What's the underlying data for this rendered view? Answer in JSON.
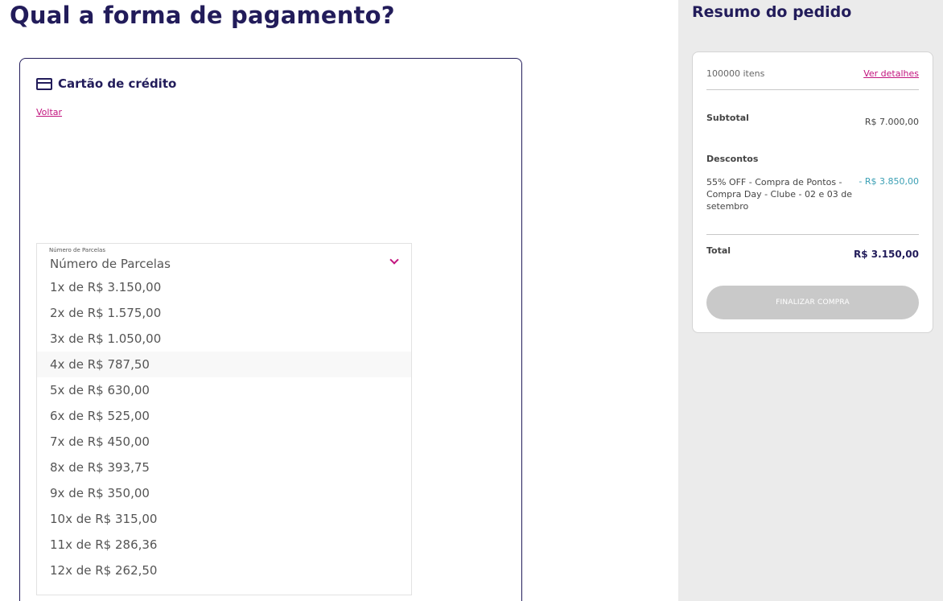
{
  "main": {
    "title": "Qual a forma de pagamento?",
    "card": {
      "title": "Cartão de crédito",
      "icon": "credit-card-icon",
      "back_label": "Voltar"
    },
    "installments": {
      "label": "Número de Parcelas",
      "value": "Número de Parcelas",
      "options": [
        "1x de R$ 3.150,00",
        "2x de R$ 1.575,00",
        "3x de R$ 1.050,00",
        "4x de R$ 787,50",
        "5x de R$ 630,00",
        "6x de R$ 525,00",
        "7x de R$ 450,00",
        "8x de R$ 393,75",
        "9x de R$ 350,00",
        "10x de R$ 315,00",
        "11x de R$ 286,36",
        "12x de R$ 262,50"
      ],
      "highlighted_index": 3
    }
  },
  "summary": {
    "title": "Resumo do pedido",
    "items_count": "100000 itens",
    "details_label": "Ver detalhes",
    "subtotal_label": "Subtotal",
    "subtotal_value": "R$ 7.000,00",
    "discounts_label": "Descontos",
    "discount_desc": "55% OFF - Compra de Pontos - Compra Day - Clube - 02 e 03 de setembro",
    "discount_value": "- R$ 3.850,00",
    "total_label": "Total",
    "total_value": "R$ 3.150,00",
    "finish_label": "FINALIZAR COMPRA"
  },
  "colors": {
    "brand": "#221c5a",
    "accent": "#c2147e",
    "discount": "#3a9fb4",
    "disabled_button": "#c9c9c9",
    "sidebar_bg": "#ebebeb"
  }
}
